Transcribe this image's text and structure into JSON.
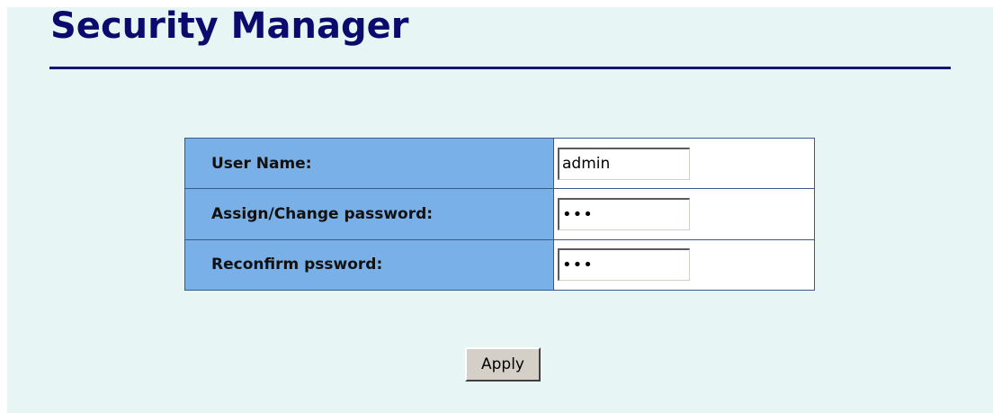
{
  "header": {
    "title": "Security Manager"
  },
  "form": {
    "rows": [
      {
        "label": "User Name:",
        "value": "admin",
        "type": "text"
      },
      {
        "label": "Assign/Change password:",
        "value": "abc",
        "type": "password"
      },
      {
        "label": "Reconfirm pssword:",
        "value": "abc",
        "type": "password"
      }
    ]
  },
  "actions": {
    "apply_label": "Apply"
  },
  "colors": {
    "page_background": "#e8f5f5",
    "title_color": "#0b0b6e",
    "label_cell_background": "#7ab0e8",
    "table_border": "#3b5a8a",
    "button_face": "#d4d0c8"
  }
}
